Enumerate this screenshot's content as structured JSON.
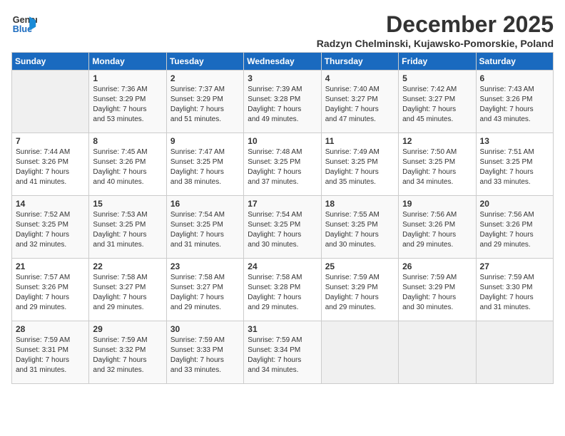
{
  "header": {
    "logo_line1": "General",
    "logo_line2": "Blue",
    "month_title": "December 2025",
    "subtitle": "Radzyn Chelminski, Kujawsko-Pomorskie, Poland"
  },
  "days_of_week": [
    "Sunday",
    "Monday",
    "Tuesday",
    "Wednesday",
    "Thursday",
    "Friday",
    "Saturday"
  ],
  "weeks": [
    [
      {
        "day": "",
        "info": ""
      },
      {
        "day": "1",
        "info": "Sunrise: 7:36 AM\nSunset: 3:29 PM\nDaylight: 7 hours\nand 53 minutes."
      },
      {
        "day": "2",
        "info": "Sunrise: 7:37 AM\nSunset: 3:29 PM\nDaylight: 7 hours\nand 51 minutes."
      },
      {
        "day": "3",
        "info": "Sunrise: 7:39 AM\nSunset: 3:28 PM\nDaylight: 7 hours\nand 49 minutes."
      },
      {
        "day": "4",
        "info": "Sunrise: 7:40 AM\nSunset: 3:27 PM\nDaylight: 7 hours\nand 47 minutes."
      },
      {
        "day": "5",
        "info": "Sunrise: 7:42 AM\nSunset: 3:27 PM\nDaylight: 7 hours\nand 45 minutes."
      },
      {
        "day": "6",
        "info": "Sunrise: 7:43 AM\nSunset: 3:26 PM\nDaylight: 7 hours\nand 43 minutes."
      }
    ],
    [
      {
        "day": "7",
        "info": "Sunrise: 7:44 AM\nSunset: 3:26 PM\nDaylight: 7 hours\nand 41 minutes."
      },
      {
        "day": "8",
        "info": "Sunrise: 7:45 AM\nSunset: 3:26 PM\nDaylight: 7 hours\nand 40 minutes."
      },
      {
        "day": "9",
        "info": "Sunrise: 7:47 AM\nSunset: 3:25 PM\nDaylight: 7 hours\nand 38 minutes."
      },
      {
        "day": "10",
        "info": "Sunrise: 7:48 AM\nSunset: 3:25 PM\nDaylight: 7 hours\nand 37 minutes."
      },
      {
        "day": "11",
        "info": "Sunrise: 7:49 AM\nSunset: 3:25 PM\nDaylight: 7 hours\nand 35 minutes."
      },
      {
        "day": "12",
        "info": "Sunrise: 7:50 AM\nSunset: 3:25 PM\nDaylight: 7 hours\nand 34 minutes."
      },
      {
        "day": "13",
        "info": "Sunrise: 7:51 AM\nSunset: 3:25 PM\nDaylight: 7 hours\nand 33 minutes."
      }
    ],
    [
      {
        "day": "14",
        "info": "Sunrise: 7:52 AM\nSunset: 3:25 PM\nDaylight: 7 hours\nand 32 minutes."
      },
      {
        "day": "15",
        "info": "Sunrise: 7:53 AM\nSunset: 3:25 PM\nDaylight: 7 hours\nand 31 minutes."
      },
      {
        "day": "16",
        "info": "Sunrise: 7:54 AM\nSunset: 3:25 PM\nDaylight: 7 hours\nand 31 minutes."
      },
      {
        "day": "17",
        "info": "Sunrise: 7:54 AM\nSunset: 3:25 PM\nDaylight: 7 hours\nand 30 minutes."
      },
      {
        "day": "18",
        "info": "Sunrise: 7:55 AM\nSunset: 3:25 PM\nDaylight: 7 hours\nand 30 minutes."
      },
      {
        "day": "19",
        "info": "Sunrise: 7:56 AM\nSunset: 3:26 PM\nDaylight: 7 hours\nand 29 minutes."
      },
      {
        "day": "20",
        "info": "Sunrise: 7:56 AM\nSunset: 3:26 PM\nDaylight: 7 hours\nand 29 minutes."
      }
    ],
    [
      {
        "day": "21",
        "info": "Sunrise: 7:57 AM\nSunset: 3:26 PM\nDaylight: 7 hours\nand 29 minutes."
      },
      {
        "day": "22",
        "info": "Sunrise: 7:58 AM\nSunset: 3:27 PM\nDaylight: 7 hours\nand 29 minutes."
      },
      {
        "day": "23",
        "info": "Sunrise: 7:58 AM\nSunset: 3:27 PM\nDaylight: 7 hours\nand 29 minutes."
      },
      {
        "day": "24",
        "info": "Sunrise: 7:58 AM\nSunset: 3:28 PM\nDaylight: 7 hours\nand 29 minutes."
      },
      {
        "day": "25",
        "info": "Sunrise: 7:59 AM\nSunset: 3:29 PM\nDaylight: 7 hours\nand 29 minutes."
      },
      {
        "day": "26",
        "info": "Sunrise: 7:59 AM\nSunset: 3:29 PM\nDaylight: 7 hours\nand 30 minutes."
      },
      {
        "day": "27",
        "info": "Sunrise: 7:59 AM\nSunset: 3:30 PM\nDaylight: 7 hours\nand 31 minutes."
      }
    ],
    [
      {
        "day": "28",
        "info": "Sunrise: 7:59 AM\nSunset: 3:31 PM\nDaylight: 7 hours\nand 31 minutes."
      },
      {
        "day": "29",
        "info": "Sunrise: 7:59 AM\nSunset: 3:32 PM\nDaylight: 7 hours\nand 32 minutes."
      },
      {
        "day": "30",
        "info": "Sunrise: 7:59 AM\nSunset: 3:33 PM\nDaylight: 7 hours\nand 33 minutes."
      },
      {
        "day": "31",
        "info": "Sunrise: 7:59 AM\nSunset: 3:34 PM\nDaylight: 7 hours\nand 34 minutes."
      },
      {
        "day": "",
        "info": ""
      },
      {
        "day": "",
        "info": ""
      },
      {
        "day": "",
        "info": ""
      }
    ]
  ]
}
